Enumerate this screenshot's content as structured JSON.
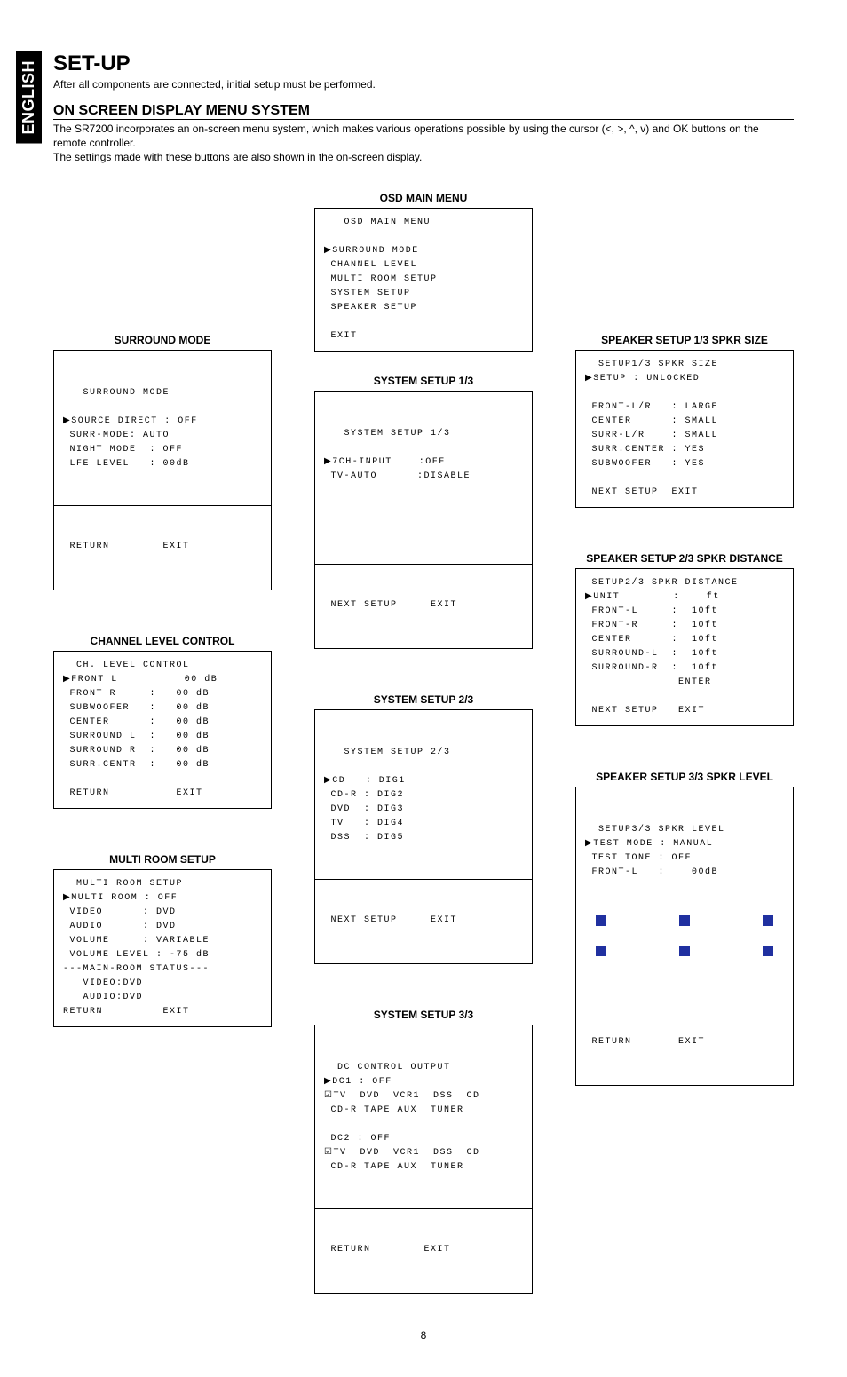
{
  "lang": "ENGLISH",
  "title": "SET-UP",
  "subtitle": "After all components are connected, initial setup must be performed.",
  "section": "ON SCREEN DISPLAY MENU SYSTEM",
  "desc1": "The SR7200 incorporates an on-screen menu system, which makes various operations possible by using the cursor (<, >, ^, v) and OK buttons on the remote controller.",
  "desc2": "The settings made with these buttons are also shown in the on-screen display.",
  "main_menu": {
    "label": "OSD MAIN MENU",
    "body": "   OSD MAIN MENU\n\n▶SURROUND MODE\n CHANNEL LEVEL\n MULTI ROOM SETUP\n SYSTEM SETUP\n SPEAKER SETUP\n\n EXIT"
  },
  "left": {
    "surround": {
      "label": "SURROUND MODE",
      "top": "   SURROUND MODE\n\n▶SOURCE DIRECT : OFF\n SURR-MODE: AUTO\n NIGHT MODE  : OFF\n LFE LEVEL   : 00dB",
      "bottom": " RETURN        EXIT"
    },
    "channel": {
      "label": "CHANNEL LEVEL CONTROL",
      "body": "  CH. LEVEL CONTROL\n▶FRONT L          00 dB\n FRONT R     :   00 dB\n SUBWOOFER   :   00 dB\n CENTER      :   00 dB\n SURROUND L  :   00 dB\n SURROUND R  :   00 dB\n SURR.CENTR  :   00 dB\n\n RETURN          EXIT"
    },
    "multi": {
      "label": "MULTI ROOM SETUP",
      "body": "  MULTI ROOM SETUP\n▶MULTI ROOM : OFF\n VIDEO      : DVD\n AUDIO      : DVD\n VOLUME     : VARIABLE\n VOLUME LEVEL : -75 dB\n---MAIN-ROOM STATUS---\n   VIDEO:DVD\n   AUDIO:DVD\nRETURN         EXIT"
    }
  },
  "center": {
    "sys1": {
      "label": "SYSTEM SETUP 1/3",
      "top": "   SYSTEM SETUP 1/3\n\n▶7CH-INPUT    :OFF\n TV-AUTO      :DISABLE",
      "bottom": " NEXT SETUP     EXIT"
    },
    "sys2": {
      "label": "SYSTEM SETUP 2/3",
      "top": "   SYSTEM SETUP 2/3\n\n▶CD   : DIG1\n CD-R : DIG2\n DVD  : DIG3\n TV   : DIG4\n DSS  : DIG5",
      "bottom": " NEXT SETUP     EXIT"
    },
    "sys3": {
      "label": "SYSTEM SETUP 3/3",
      "top": "  DC CONTROL OUTPUT\n▶DC1 : OFF\n☑TV  DVD  VCR1  DSS  CD\n CD-R TAPE AUX  TUNER\n\n DC2 : OFF\n☑TV  DVD  VCR1  DSS  CD\n CD-R TAPE AUX  TUNER",
      "bottom": " RETURN        EXIT"
    }
  },
  "right": {
    "spk1": {
      "label": "SPEAKER SETUP 1/3 SPKR SIZE",
      "body": "  SETUP1/3 SPKR SIZE\n▶SETUP : UNLOCKED\n\n FRONT-L/R   : LARGE\n CENTER      : SMALL\n SURR-L/R    : SMALL\n SURR.CENTER : YES\n SUBWOOFER   : YES\n\n NEXT SETUP  EXIT"
    },
    "spk2": {
      "label": "SPEAKER SETUP 2/3 SPKR DISTANCE",
      "body": " SETUP2/3 SPKR DISTANCE\n▶UNIT        :    ft\n FRONT-L     :  10ft\n FRONT-R     :  10ft\n CENTER      :  10ft\n SURROUND-L  :  10ft\n SURROUND-R  :  10ft\n              ENTER\n\n NEXT SETUP   EXIT"
    },
    "spk3": {
      "label": "SPEAKER SETUP 3/3 SPKR LEVEL",
      "head": "  SETUP3/3 SPKR LEVEL\n▶TEST MODE : MANUAL\n TEST TONE : OFF\n FRONT-L   :    00dB",
      "bottom": " RETURN       EXIT"
    }
  },
  "page": "8"
}
